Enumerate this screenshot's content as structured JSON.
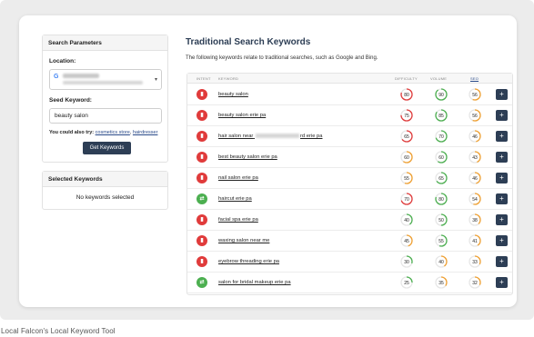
{
  "caption": "Local Falcon's Local Keyword Tool",
  "params": {
    "heading": "Search Parameters",
    "location_label": "Location:",
    "seed_label": "Seed Keyword:",
    "seed_value": "beauty salon",
    "also_prefix": "You could also try:",
    "also_links": [
      "cosmetics store",
      "hairdresser"
    ],
    "get_button": "Get Keywords"
  },
  "selected": {
    "heading": "Selected Keywords",
    "empty_text": "No keywords selected"
  },
  "main": {
    "title": "Traditional Search Keywords",
    "description": "The following keywords relate to traditional searches, such as Google and Bing."
  },
  "table": {
    "columns": [
      "INTENT",
      "KEYWORD",
      "DIFFICULTY",
      "VOLUME",
      "SEO"
    ],
    "colors": {
      "red": "#e03b3b",
      "green": "#4caf50",
      "orange": "#f0a030",
      "dark": "#2d3e55"
    },
    "rows": [
      {
        "intent": "red",
        "keyword": "beauty salon",
        "difficulty": 80,
        "volume": 90,
        "seo": 56
      },
      {
        "intent": "red",
        "keyword": "beauty salon erie pa",
        "difficulty": 75,
        "volume": 85,
        "seo": 56
      },
      {
        "intent": "red",
        "keyword_pre": "hair salon near",
        "keyword_post": "rd erie pa",
        "difficulty": 65,
        "volume": 70,
        "seo": 46
      },
      {
        "intent": "red",
        "keyword": "best beauty salon erie pa",
        "difficulty": 60,
        "volume": 60,
        "seo": 43
      },
      {
        "intent": "red",
        "keyword": "nail salon erie pa",
        "difficulty": 55,
        "volume": 65,
        "seo": 46
      },
      {
        "intent": "green",
        "keyword": "haircut erie pa",
        "difficulty": 70,
        "volume": 80,
        "seo": 54
      },
      {
        "intent": "red",
        "keyword": "facial spa erie pa",
        "difficulty": 40,
        "volume": 50,
        "seo": 38
      },
      {
        "intent": "red",
        "keyword": "waxing salon near me",
        "difficulty": 45,
        "volume": 55,
        "seo": 41
      },
      {
        "intent": "red",
        "keyword": "eyebrow threading erie pa",
        "difficulty": 30,
        "volume": 40,
        "seo": 33
      },
      {
        "intent": "green",
        "keyword": "salon for bridal makeup erie pa",
        "difficulty": 25,
        "volume": 35,
        "seo": 32
      }
    ],
    "add_label": "+"
  }
}
